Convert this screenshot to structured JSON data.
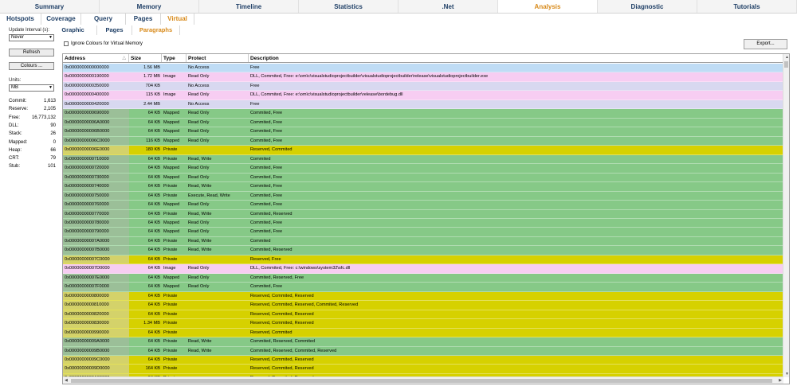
{
  "tabs1": [
    "Summary",
    "Memory",
    "Timeline",
    "Statistics",
    ".Net",
    "Analysis",
    "Diagnostic",
    "Tutorials"
  ],
  "tabs1_active": 5,
  "tabs2": [
    "Hotspots",
    "Coverage",
    "Query",
    "Pages",
    "Virtual"
  ],
  "tabs2_active": 4,
  "tabs3": [
    "Graphic",
    "Pages",
    "Paragraphs"
  ],
  "tabs3_active": 2,
  "left": {
    "update_label": "Update Interval (s):",
    "update_value": "Never",
    "refresh": "Refresh",
    "colours": "Colours ...",
    "units_label": "Units:",
    "units_value": "MB",
    "stats": [
      {
        "label": "Commit:",
        "value": "1,613"
      },
      {
        "label": "Reserve:",
        "value": "2,105"
      },
      {
        "label": "Free:",
        "value": "16,773,132"
      },
      {
        "label": "DLL:",
        "value": "90"
      },
      {
        "label": "Stack:",
        "value": "26"
      },
      {
        "label": "Mapped:",
        "value": "0"
      },
      {
        "label": "Heap:",
        "value": "66"
      },
      {
        "label": "CRT:",
        "value": "79"
      },
      {
        "label": "Stub:",
        "value": "101"
      }
    ]
  },
  "ignore_colours": "Ignore Colours for Virtual Memory",
  "export": "Export...",
  "columns": [
    "Address",
    "Size",
    "Type",
    "Protect",
    "Description"
  ],
  "row_colors": {
    "free": "#bfdcf5",
    "image": "#f7cdf2",
    "free2": "#d8d8f0",
    "mapped": "#86c987",
    "private": "#d6d100",
    "addr_mapped": "#9bbf98",
    "addr_private": "#d4d26a"
  },
  "rows": [
    {
      "addr": "0x0000000000000000",
      "size": "1.56 MB",
      "type": "",
      "protect": "No Access",
      "desc": "Free",
      "kind": "free"
    },
    {
      "addr": "0x0000000000190000",
      "size": "1.72 MB",
      "type": "Image",
      "protect": "Read Only",
      "desc": "DLL, Commited, Free: e:\\om\\c\\visualstudioprojectbuilder\\visualstudioprojectbuilder\\release\\visualstudioprojectbuilder.exe",
      "kind": "image"
    },
    {
      "addr": "0x0000000000350000",
      "size": "704 KB",
      "type": "",
      "protect": "No Access",
      "desc": "Free",
      "kind": "free2"
    },
    {
      "addr": "0x0000000000400000",
      "size": "115 KB",
      "type": "Image",
      "protect": "Read Only",
      "desc": "DLL, Commited, Free: e:\\om\\c\\visualstudioprojectbuilder\\release\\bordebug.dll",
      "kind": "image"
    },
    {
      "addr": "0x0000000000420000",
      "size": "2.44 MB",
      "type": "",
      "protect": "No Access",
      "desc": "Free",
      "kind": "free2"
    },
    {
      "addr": "0x0000000000690000",
      "size": "64 KB",
      "type": "Mapped",
      "protect": "Read Only",
      "desc": "Commited, Free",
      "kind": "mapped"
    },
    {
      "addr": "0x00000000006A0000",
      "size": "64 KB",
      "type": "Mapped",
      "protect": "Read Only",
      "desc": "Commited, Free",
      "kind": "mapped"
    },
    {
      "addr": "0x00000000006B0000",
      "size": "64 KB",
      "type": "Mapped",
      "protect": "Read Only",
      "desc": "Commited, Free",
      "kind": "mapped"
    },
    {
      "addr": "0x00000000006C0000",
      "size": "116 KB",
      "type": "Mapped",
      "protect": "Read Only",
      "desc": "Commited, Free",
      "kind": "mapped"
    },
    {
      "addr": "0x00000000006E0000",
      "size": "180 KB",
      "type": "Private",
      "protect": "",
      "desc": "Reserved, Commited",
      "kind": "private"
    },
    {
      "addr": "0x0000000000710000",
      "size": "64 KB",
      "type": "Private",
      "protect": "Read, Write",
      "desc": "Commited",
      "kind": "mapped"
    },
    {
      "addr": "0x0000000000720000",
      "size": "64 KB",
      "type": "Mapped",
      "protect": "Read Only",
      "desc": "Commited, Free",
      "kind": "mapped"
    },
    {
      "addr": "0x0000000000730000",
      "size": "64 KB",
      "type": "Mapped",
      "protect": "Read Only",
      "desc": "Commited, Free",
      "kind": "mapped"
    },
    {
      "addr": "0x0000000000740000",
      "size": "64 KB",
      "type": "Private",
      "protect": "Read, Write",
      "desc": "Commited, Free",
      "kind": "mapped"
    },
    {
      "addr": "0x0000000000750000",
      "size": "64 KB",
      "type": "Private",
      "protect": "Execute, Read, Write",
      "desc": "Commited, Free",
      "kind": "mapped"
    },
    {
      "addr": "0x0000000000760000",
      "size": "64 KB",
      "type": "Mapped",
      "protect": "Read Only",
      "desc": "Commited, Free",
      "kind": "mapped"
    },
    {
      "addr": "0x0000000000770000",
      "size": "64 KB",
      "type": "Private",
      "protect": "Read, Write",
      "desc": "Commited, Reserved",
      "kind": "mapped"
    },
    {
      "addr": "0x0000000000780000",
      "size": "64 KB",
      "type": "Mapped",
      "protect": "Read Only",
      "desc": "Commited, Free",
      "kind": "mapped"
    },
    {
      "addr": "0x0000000000790000",
      "size": "64 KB",
      "type": "Mapped",
      "protect": "Read Only",
      "desc": "Commited, Free",
      "kind": "mapped"
    },
    {
      "addr": "0x00000000007A0000",
      "size": "64 KB",
      "type": "Private",
      "protect": "Read, Write",
      "desc": "Commited",
      "kind": "mapped"
    },
    {
      "addr": "0x00000000007B0000",
      "size": "64 KB",
      "type": "Private",
      "protect": "Read, Write",
      "desc": "Commited, Reserved",
      "kind": "mapped"
    },
    {
      "addr": "0x00000000007C0000",
      "size": "64 KB",
      "type": "Private",
      "protect": "",
      "desc": "Reserved, Free",
      "kind": "private"
    },
    {
      "addr": "0x00000000007D0000",
      "size": "64 KB",
      "type": "Image",
      "protect": "Read Only",
      "desc": "DLL, Commited, Free: c:\\windows\\system32\\sfc.dll",
      "kind": "image"
    },
    {
      "addr": "0x00000000007E0000",
      "size": "64 KB",
      "type": "Mapped",
      "protect": "Read Only",
      "desc": "Commited, Reserved, Free",
      "kind": "mapped"
    },
    {
      "addr": "0x00000000007F0000",
      "size": "64 KB",
      "type": "Mapped",
      "protect": "Read Only",
      "desc": "Commited, Free",
      "kind": "mapped"
    },
    {
      "addr": "0x0000000000800000",
      "size": "64 KB",
      "type": "Private",
      "protect": "",
      "desc": "Reserved, Commited, Reserved",
      "kind": "private"
    },
    {
      "addr": "0x0000000000810000",
      "size": "64 KB",
      "type": "Private",
      "protect": "",
      "desc": "Reserved, Commited, Reserved, Commited, Reserved",
      "kind": "private"
    },
    {
      "addr": "0x0000000000820000",
      "size": "64 KB",
      "type": "Private",
      "protect": "",
      "desc": "Reserved, Commited, Reserved",
      "kind": "private"
    },
    {
      "addr": "0x0000000000830000",
      "size": "1.34 MB",
      "type": "Private",
      "protect": "",
      "desc": "Reserved, Commited, Reserved",
      "kind": "private"
    },
    {
      "addr": "0x0000000000990000",
      "size": "64 KB",
      "type": "Private",
      "protect": "",
      "desc": "Reserved, Commited",
      "kind": "private"
    },
    {
      "addr": "0x00000000009A0000",
      "size": "64 KB",
      "type": "Private",
      "protect": "Read, Write",
      "desc": "Commited, Reserved, Commited",
      "kind": "mapped"
    },
    {
      "addr": "0x00000000009B0000",
      "size": "64 KB",
      "type": "Private",
      "protect": "Read, Write",
      "desc": "Commited, Reserved, Commited, Reserved",
      "kind": "mapped"
    },
    {
      "addr": "0x00000000009C0000",
      "size": "64 KB",
      "type": "Private",
      "protect": "",
      "desc": "Reserved, Commited, Reserved",
      "kind": "private"
    },
    {
      "addr": "0x00000000009D0000",
      "size": "164 KB",
      "type": "Private",
      "protect": "",
      "desc": "Reserved, Commited, Reserved",
      "kind": "private"
    },
    {
      "addr": "0x0000000000A00000",
      "size": "64 KB",
      "type": "Private",
      "protect": "",
      "desc": "Reserved, Commited, Reserved",
      "kind": "private"
    }
  ]
}
